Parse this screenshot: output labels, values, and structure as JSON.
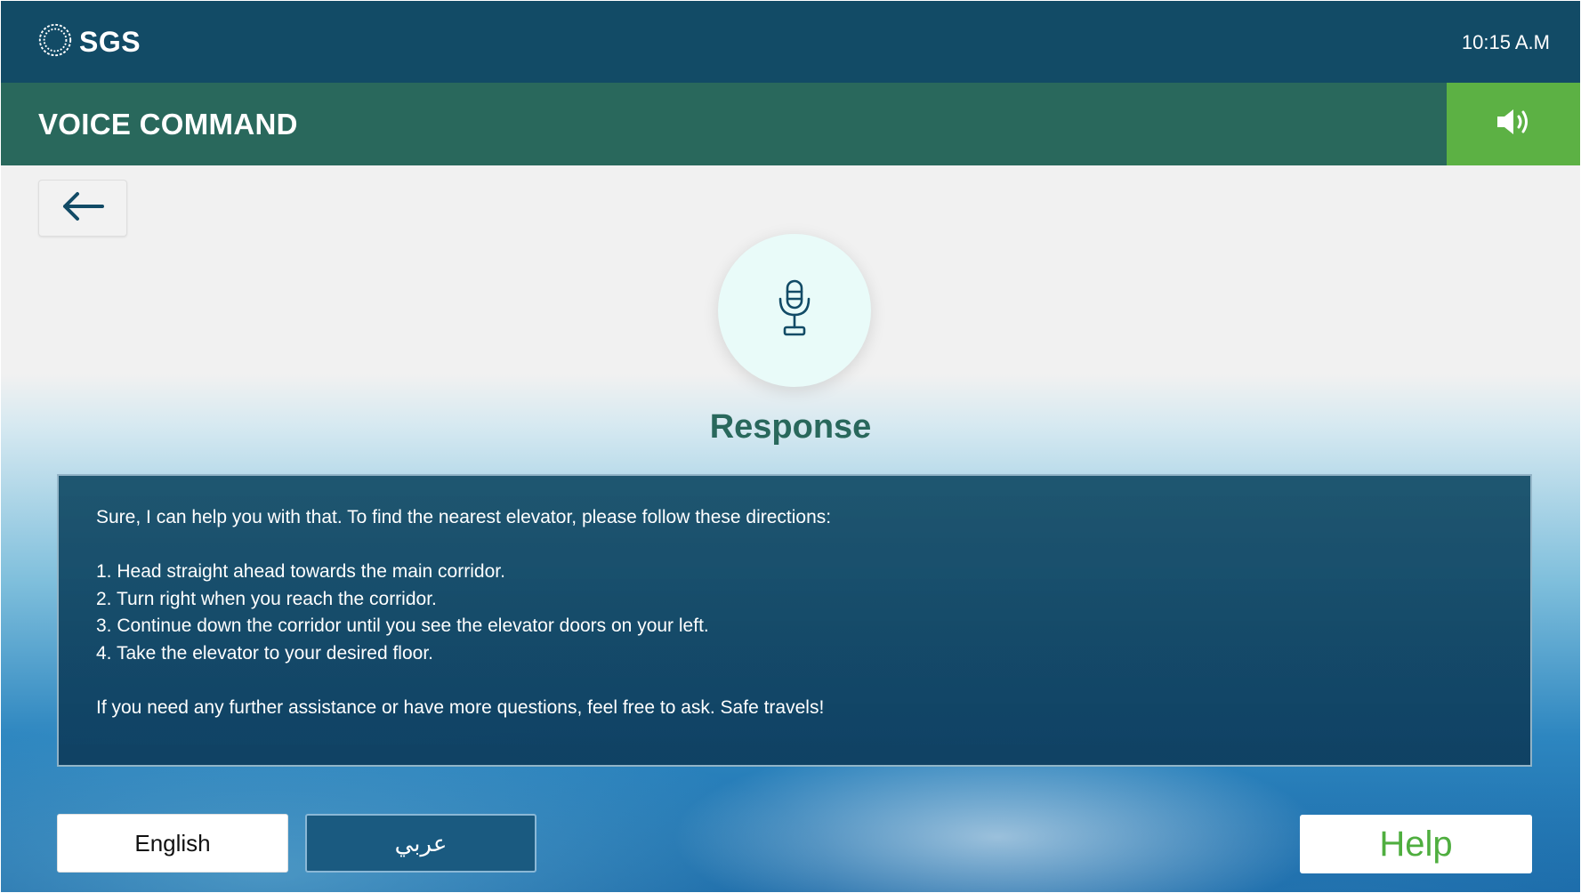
{
  "header": {
    "logo_text": "SGS",
    "logo_icon": "sgs-logo-icon",
    "time": "10:15 A.M"
  },
  "title_bar": {
    "title": "VOICE COMMAND",
    "speaker_icon": "speaker-volume-icon"
  },
  "nav": {
    "back_icon": "arrow-left-icon"
  },
  "main": {
    "mic_icon": "microphone-icon",
    "response_heading": "Response",
    "response": {
      "intro": "Sure, I can help you with that. To find the nearest elevator, please follow these directions:",
      "steps": [
        "1. Head straight ahead towards the main corridor.",
        "2. Turn right when you reach the corridor.",
        "3. Continue down the corridor until you see the elevator doors on your left.",
        "4. Take the elevator to your desired floor."
      ],
      "closing": "If you need any further assistance or have more questions, feel free to ask. Safe travels!"
    }
  },
  "footer": {
    "english_label": "English",
    "arabic_label": "عربي",
    "help_label": "Help"
  },
  "colors": {
    "header_bg": "#124b66",
    "title_bar_bg": "#29685c",
    "speaker_bg": "#5cb144",
    "help_text": "#4fae3f",
    "panel_bg": "#124b66"
  }
}
